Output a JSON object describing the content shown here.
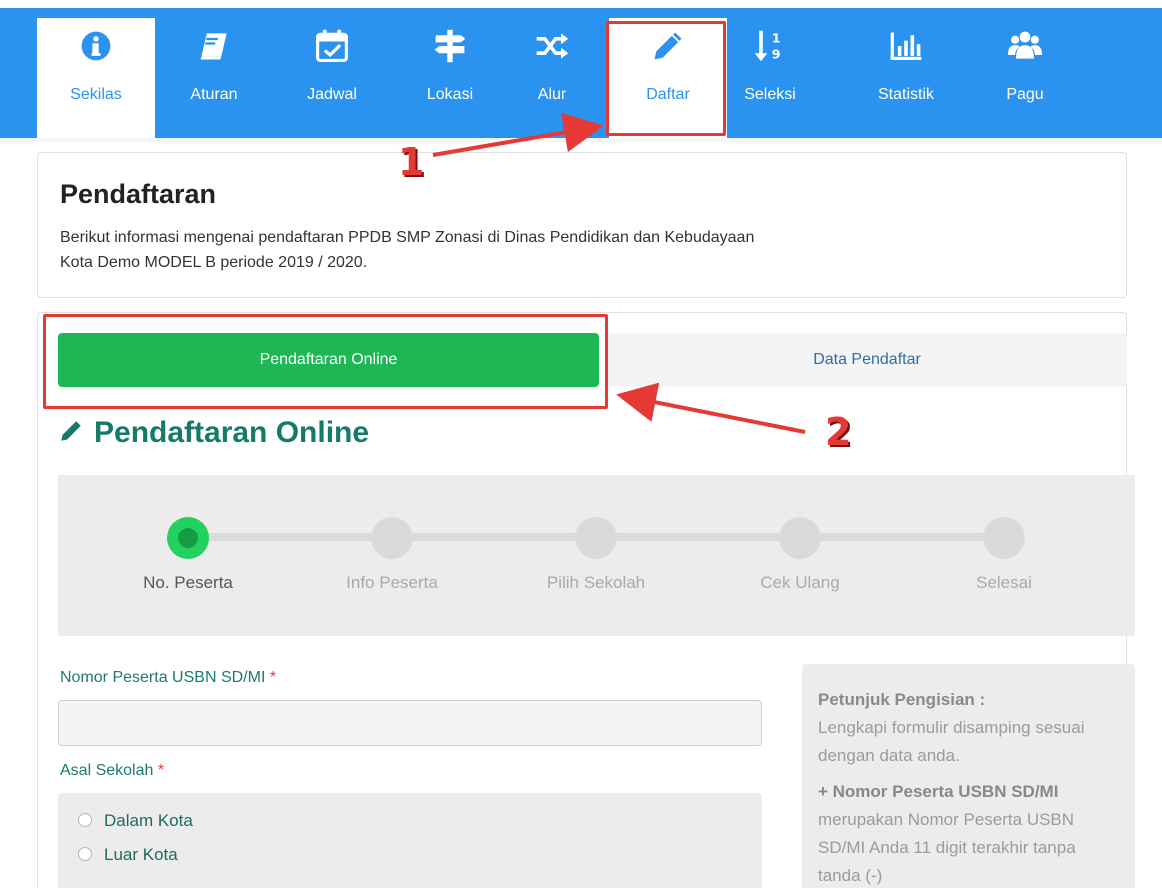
{
  "nav": {
    "items": [
      {
        "label": "Sekilas",
        "icon": "info-icon"
      },
      {
        "label": "Aturan",
        "icon": "book-icon"
      },
      {
        "label": "Jadwal",
        "icon": "calendar-check-icon"
      },
      {
        "label": "Lokasi",
        "icon": "signpost-icon"
      },
      {
        "label": "Alur",
        "icon": "shuffle-icon"
      },
      {
        "label": "Daftar",
        "icon": "pencil-icon"
      },
      {
        "label": "Seleksi",
        "icon": "sort-numeric-icon"
      },
      {
        "label": "Statistik",
        "icon": "bar-chart-icon"
      },
      {
        "label": "Pagu",
        "icon": "users-icon"
      }
    ],
    "active_index": 0
  },
  "annotations": {
    "marker1": "1",
    "marker2": "2",
    "color": "#e53935"
  },
  "intro": {
    "title": "Pendaftaran",
    "description": "Berikut informasi mengenai pendaftaran PPDB SMP Zonasi di Dinas Pendidikan dan Kebudayaan Kota Demo MODEL B periode 2019 / 2020."
  },
  "tabs": {
    "online": "Pendaftaran Online",
    "data": "Data Pendaftar"
  },
  "section": {
    "title": "Pendaftaran Online"
  },
  "steps": [
    {
      "label": "No. Peserta",
      "active": true
    },
    {
      "label": "Info Peserta",
      "active": false
    },
    {
      "label": "Pilih Sekolah",
      "active": false
    },
    {
      "label": "Cek Ulang",
      "active": false
    },
    {
      "label": "Selesai",
      "active": false
    }
  ],
  "form": {
    "nomor_label": "Nomor Peserta USBN SD/MI",
    "required_mark": "*",
    "nomor_value": "",
    "asal_label": "Asal Sekolah",
    "options": [
      "Dalam Kota",
      "Luar Kota"
    ]
  },
  "help": {
    "title": "Petunjuk Pengisian :",
    "text1": "Lengkapi formulir disamping sesuai dengan data anda.",
    "subtitle": "+ Nomor Peserta USBN SD/MI",
    "text2": "merupakan Nomor Peserta USBN SD/MI Anda 11 digit terakhir tanpa tanda (-)"
  },
  "colors": {
    "nav_blue": "#2a93ef",
    "green": "#1db756",
    "teal": "#157a66"
  }
}
